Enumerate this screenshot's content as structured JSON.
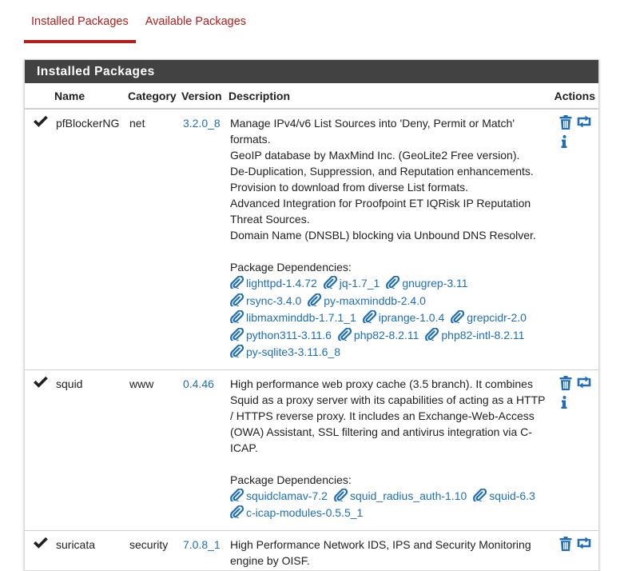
{
  "tabs": [
    {
      "label": "Installed Packages",
      "active": true
    },
    {
      "label": "Available Packages",
      "active": false
    }
  ],
  "panel": {
    "title": "Installed Packages"
  },
  "table": {
    "headers": {
      "name": "Name",
      "category": "Category",
      "version": "Version",
      "description": "Description",
      "actions": "Actions"
    },
    "deps_label": "Package Dependencies:",
    "rows": [
      {
        "name": "pfBlockerNG",
        "category": "net",
        "version": "3.2.0_8",
        "description": [
          "Manage IPv4/v6 List Sources into 'Deny, Permit or Match'",
          "formats.",
          "GeoIP database by MaxMind Inc. (GeoLite2 Free version).",
          "De-Duplication, Suppression, and Reputation enhancements.",
          "Provision to download from diverse List formats.",
          "Advanced Integration for Proofpoint ET IQRisk IP Reputation",
          "Threat Sources.",
          "Domain Name (DNSBL) blocking via Unbound DNS Resolver."
        ],
        "dependencies": [
          "lighttpd-1.4.72",
          "jq-1.7_1",
          "gnugrep-3.11",
          "rsync-3.4.0",
          "py-maxminddb-2.4.0",
          "libmaxminddb-1.7.1_1",
          "iprange-1.0.4",
          "grepcidr-2.0",
          "python311-3.11.6",
          "php82-8.2.11",
          "php82-intl-8.2.11",
          "py-sqlite3-3.11.6_8"
        ]
      },
      {
        "name": "squid",
        "category": "www",
        "version": "0.4.46",
        "description": [
          "High performance web proxy cache (3.5 branch). It combines",
          "Squid as a proxy server with its capabilities of acting as a HTTP",
          "/ HTTPS reverse proxy. It includes an Exchange-Web-Access",
          "(OWA) Assistant, SSL filtering and antivirus integration via C-",
          "ICAP."
        ],
        "dependencies": [
          "squidclamav-7.2",
          "squid_radius_auth-1.10",
          "squid-6.3",
          "c-icap-modules-0.5.5_1"
        ]
      },
      {
        "name": "suricata",
        "category": "security",
        "version": "7.0.8_1",
        "description": [
          "High Performance Network IDS, IPS and Security Monitoring",
          "engine by OISF."
        ],
        "dependencies": []
      }
    ]
  },
  "icons": {
    "installed": "check-icon",
    "remove": "trash-icon",
    "reinstall": "reinstall-icon",
    "info": "info-icon",
    "dependency": "paperclip-icon"
  },
  "colors": {
    "accent": "#b71c1c",
    "link": "#1e6fb7",
    "panel_heading": "#424242"
  }
}
